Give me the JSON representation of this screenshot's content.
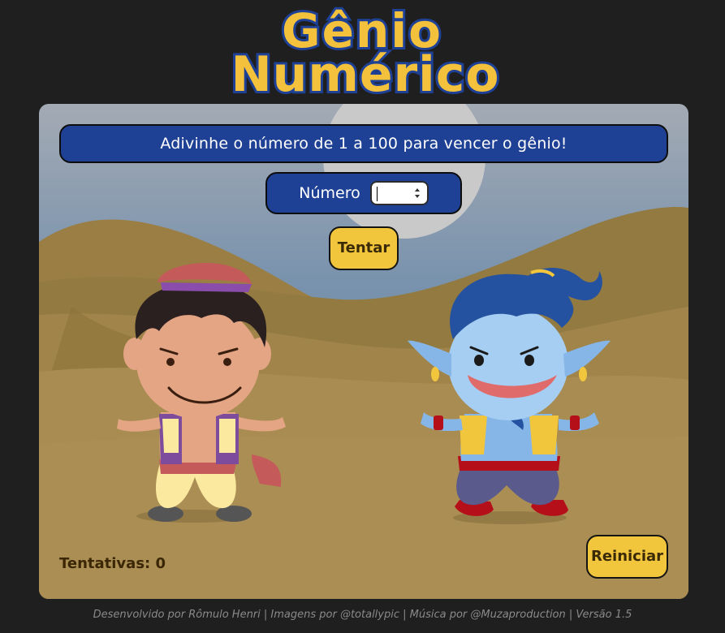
{
  "header": {
    "logo_line1": "Gênio",
    "logo_line2": "Numérico"
  },
  "game": {
    "banner": "Adivinhe o número de 1 a 100 para vencer o gênio!",
    "number_label": "Número",
    "number_value": "",
    "try_button": "Tentar",
    "reset_button": "Reiniciar",
    "attempts_label": "Tentativas: 0"
  },
  "footer": {
    "credits": "Desenvolvido por Rômulo Henri | Imagens por @totallypic | Música por @Muzaproduction | Versão 1.5"
  },
  "colors": {
    "background": "#1f1f1f",
    "accent_blue": "#1e4196",
    "accent_yellow": "#f2c63c",
    "sand": "#a9894e"
  },
  "icons": {
    "spinner": "number-spinner-arrows-icon"
  }
}
